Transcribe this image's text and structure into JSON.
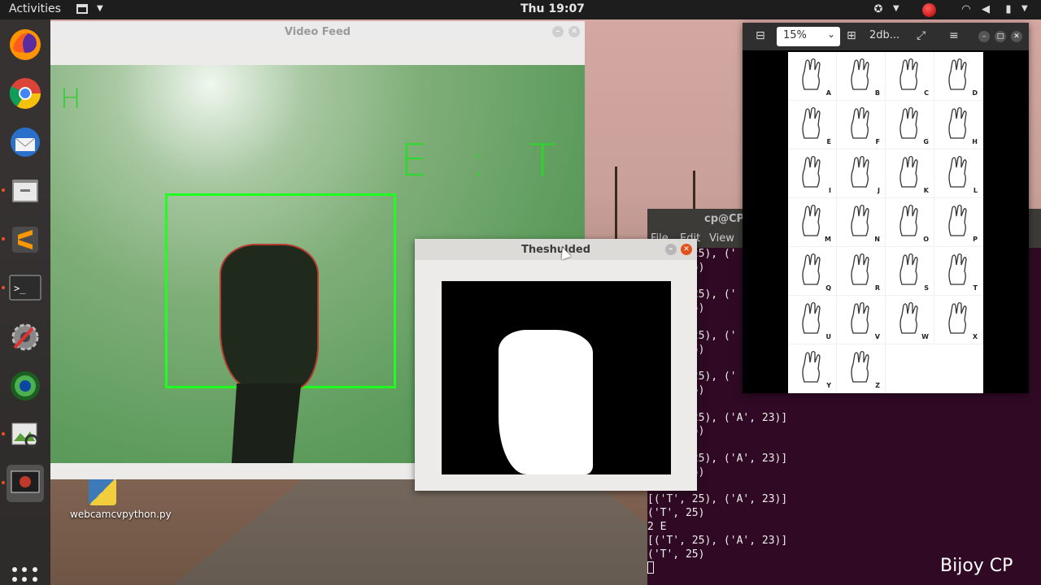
{
  "topbar": {
    "activities": "Activities",
    "clock": "Thu 19:07"
  },
  "dock": {
    "items": [
      "firefox-icon",
      "chrome-icon",
      "thunderbird-icon",
      "files-icon",
      "sublime-icon",
      "terminal-icon",
      "settings-icon",
      "browser-globe-icon",
      "image-viewer-icon",
      "screen-recorder-icon"
    ]
  },
  "video_window": {
    "title": "Video Feed",
    "current_letter": "H",
    "prediction_text": "E : T"
  },
  "threshold_window": {
    "title": "Theshulded"
  },
  "terminal": {
    "title": "cp@CP:",
    "menu": [
      "File",
      "Edit",
      "View"
    ],
    "lines": [
      "[('T', 25), ('",
      "('T', 25)",
      "",
      "[('T', 25), ('",
      "('T', 25)",
      "",
      "[('T', 25), ('",
      "('T', 25)",
      "",
      "[('T', 25), ('",
      "('T', 25)",
      "",
      "[('T', 25), ('A', 23)]",
      "('T', 25)",
      "",
      "[('T', 25), ('A', 23)]",
      "('T', 25)",
      "2 E",
      "[('T', 25), ('A', 23)]",
      "('T', 25)",
      "2 E",
      "[('T', 25), ('A', 23)]",
      "('T', 25)"
    ]
  },
  "image_viewer": {
    "zoom": "15%",
    "filename": "2db...",
    "letters": [
      "A",
      "B",
      "C",
      "D",
      "E",
      "F",
      "G",
      "H",
      "I",
      "J",
      "K",
      "L",
      "M",
      "N",
      "O",
      "P",
      "Q",
      "R",
      "S",
      "T",
      "U",
      "V",
      "W",
      "X",
      "Y",
      "Z"
    ]
  },
  "desktop": {
    "file_label": "webcamcvpython.py"
  },
  "watermark": "Bijoy CP"
}
